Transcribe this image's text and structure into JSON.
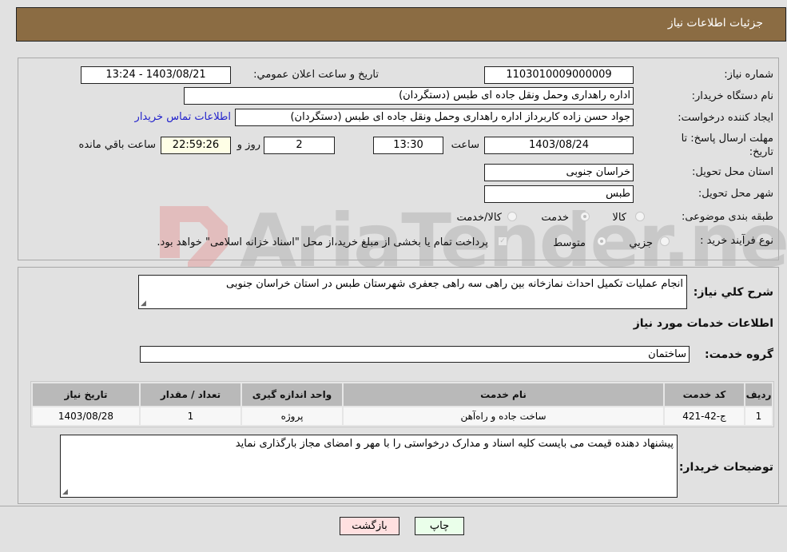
{
  "header": {
    "title": "جزئیات اطلاعات نیاز"
  },
  "watermark": "AriaTender.neT",
  "details": {
    "need_number_label": "شماره نیاز:",
    "need_number": "1103010009000009",
    "announce_label": "تاریخ و ساعت اعلان عمومي:",
    "announce_value": "1403/08/21 - 13:24",
    "buyer_org_label": "نام دستگاه خریدار:",
    "buyer_org": "اداره راهداری وحمل ونقل جاده ای طبس (دستگردان)",
    "creator_label": "ایجاد کننده درخواست:",
    "creator": "جواد حسن زاده کاربرداز اداره راهداری وحمل ونقل جاده ای طبس (دستگردان)",
    "contact_link": "اطلاعات تماس خریدار",
    "deadline_label": "مهلت ارسال پاسخ: تا تاریخ:",
    "deadline_date": "1403/08/24",
    "time_label": "ساعت",
    "deadline_time": "13:30",
    "days_value": "2",
    "days_label": "روز و",
    "remaining_time": "22:59:26",
    "remaining_label": "ساعت باقي مانده",
    "province_label": "استان محل تحویل:",
    "province": "خراسان جنوبی",
    "city_label": "شهر محل تحویل:",
    "city": "طبس",
    "category_label": "طبقه بندی موضوعی:",
    "category_options": [
      {
        "label": "کالا",
        "checked": false
      },
      {
        "label": "خدمت",
        "checked": true
      },
      {
        "label": "کالا/خدمت",
        "checked": false
      }
    ],
    "process_label": "نوع فرآیند خرید :",
    "process_options": [
      {
        "label": "جزيي",
        "checked": false
      },
      {
        "label": "متوسط",
        "checked": true
      }
    ],
    "payment_checkbox_checked": true,
    "payment_note": "پرداخت تمام یا بخشی از مبلغ خرید،از محل \"اسناد خزانه اسلامی\" خواهد بود."
  },
  "description": {
    "label": "شرح کلي نیاز:",
    "value": "انجام عملیات تکمیل احداث نمازخانه بین راهی سه راهی جعفری شهرستان طبس در استان خراسان جنوبی"
  },
  "services": {
    "section_title": "اطلاعات خدمات مورد نیاز",
    "group_label": "گروه خدمت:",
    "group_value": "ساختمان",
    "columns": [
      "ردیف",
      "کد خدمت",
      "نام خدمت",
      "واحد اندازه گیری",
      "تعداد / مقدار",
      "تاریخ نیاز"
    ],
    "rows": [
      [
        "1",
        "ج-42-421",
        "ساخت جاده و راه‌آهن",
        "پروژه",
        "1",
        "1403/08/28"
      ]
    ]
  },
  "buyer_notes": {
    "label": "توضیحات خریدار:",
    "value": "پیشنهاد دهنده قیمت می بایست کلیه اسناد و مدارک درخواستی را با مهر و امضای مجاز بارگذاری نماید"
  },
  "buttons": {
    "print": "چاپ",
    "back": "بازگشت"
  },
  "colors": {
    "header_bg": "#8b6c43",
    "print_bg": "#eaffea",
    "back_bg": "#ffe0e0",
    "link": "#2222cc"
  }
}
